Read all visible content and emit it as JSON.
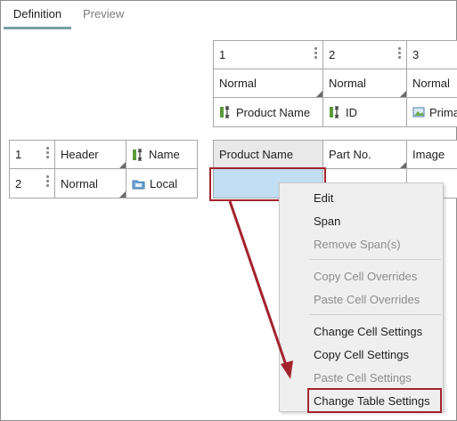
{
  "tabs": [
    {
      "label": "Definition",
      "active": true
    },
    {
      "label": "Preview",
      "active": false
    }
  ],
  "column_headers": [
    {
      "number": "1",
      "style": "Normal",
      "field": "Product Name",
      "field_icon": "field-icon"
    },
    {
      "number": "2",
      "style": "Normal",
      "field": "ID",
      "field_icon": "field-icon"
    },
    {
      "number": "3",
      "style": "Normal",
      "field": "Prima",
      "field_icon": "image-field-icon"
    }
  ],
  "row_headers": [
    {
      "number": "1",
      "style": "Header",
      "source": "Name",
      "source_icon": "field-icon"
    },
    {
      "number": "2",
      "style": "Normal",
      "source": "Local",
      "source_icon": "local-folder-icon"
    }
  ],
  "grid": {
    "header_row": [
      "Product Name",
      "Part No.",
      "Image"
    ]
  },
  "context_menu": {
    "items": [
      {
        "label": "Edit",
        "enabled": true
      },
      {
        "label": "Span",
        "enabled": true
      },
      {
        "label": "Remove Span(s)",
        "enabled": false
      },
      {
        "label": "Copy Cell Overrides",
        "enabled": false
      },
      {
        "label": "Paste Cell Overrides",
        "enabled": false
      },
      {
        "label": "Change Cell Settings",
        "enabled": true
      },
      {
        "label": "Copy Cell Settings",
        "enabled": true
      },
      {
        "label": "Paste Cell Settings",
        "enabled": false
      },
      {
        "label": "Change Table Settings",
        "enabled": true,
        "highlighted": true
      }
    ]
  },
  "colors": {
    "selected_cell": "#c1def3",
    "highlight_red": "#a3232e",
    "tab_underline": "#7a9ea3"
  }
}
